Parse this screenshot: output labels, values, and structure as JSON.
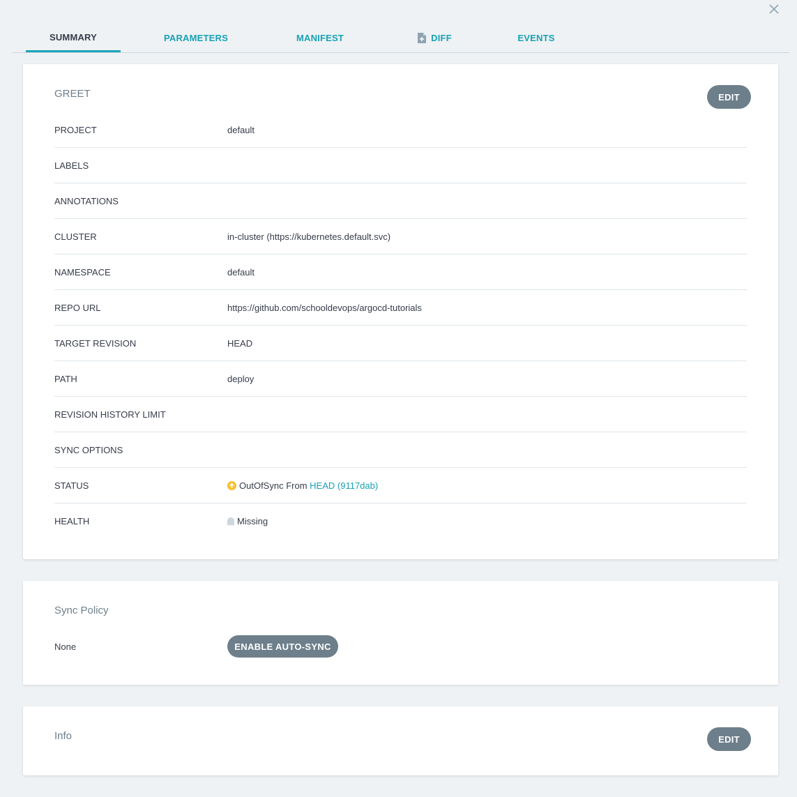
{
  "tabs": [
    {
      "label": "SUMMARY",
      "active": true
    },
    {
      "label": "PARAMETERS",
      "active": false
    },
    {
      "label": "MANIFEST",
      "active": false
    },
    {
      "label": "DIFF",
      "active": false
    },
    {
      "label": "EVENTS",
      "active": false
    }
  ],
  "summary": {
    "title": "GREET",
    "edit_label": "EDIT",
    "rows": {
      "project": {
        "key": "PROJECT",
        "value": "default"
      },
      "labels": {
        "key": "LABELS",
        "value": ""
      },
      "annotations": {
        "key": "ANNOTATIONS",
        "value": ""
      },
      "cluster": {
        "key": "CLUSTER",
        "value": "in-cluster (https://kubernetes.default.svc)"
      },
      "namespace": {
        "key": "NAMESPACE",
        "value": "default"
      },
      "repo_url": {
        "key": "REPO URL",
        "value": "https://github.com/schooldevops/argocd-tutorials"
      },
      "target_revision": {
        "key": "TARGET REVISION",
        "value": "HEAD"
      },
      "path": {
        "key": "PATH",
        "value": "deploy"
      },
      "revision_history_limit": {
        "key": "REVISION HISTORY LIMIT",
        "value": ""
      },
      "sync_options": {
        "key": "SYNC OPTIONS",
        "value": ""
      },
      "status": {
        "key": "STATUS",
        "text": "OutOfSync From",
        "revision": "HEAD (9117dab)",
        "icon": "arrow-up-circle-icon",
        "color": "#f4c030"
      },
      "health": {
        "key": "HEALTH",
        "value": "Missing",
        "icon": "ghost-icon",
        "color": "#ccd6dd"
      }
    }
  },
  "sync_policy": {
    "title": "Sync Policy",
    "value": "None",
    "button_label": "ENABLE AUTO-SYNC"
  },
  "info": {
    "title": "Info",
    "edit_label": "EDIT"
  },
  "colors": {
    "accent": "#18a1b5",
    "button": "#6d7f8b",
    "background": "#eef2f4"
  }
}
